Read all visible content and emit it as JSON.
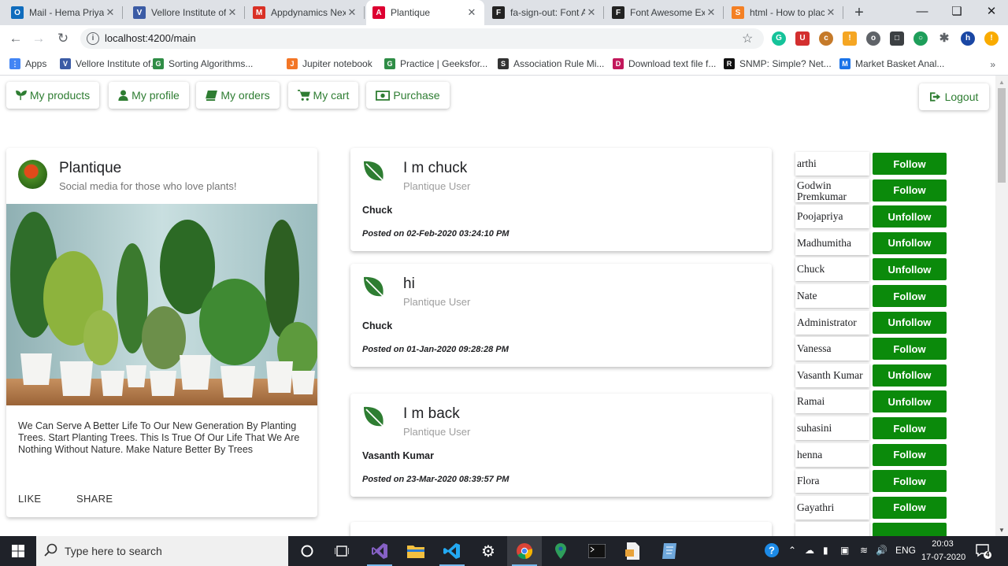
{
  "browser": {
    "tabs": [
      {
        "title": "Mail - Hema Priya",
        "favicon": "outlook-icon",
        "color": "#0f6cbd",
        "glyph": "O"
      },
      {
        "title": "Vellore Institute of",
        "favicon": "vit-icon",
        "color": "#3b5ba5",
        "glyph": "V"
      },
      {
        "title": "Appdynamics Nex",
        "favicon": "gmail-icon",
        "color": "#d93025",
        "glyph": "M"
      },
      {
        "title": "Plantique",
        "favicon": "angular-icon",
        "color": "#dd0031",
        "glyph": "A",
        "active": true
      },
      {
        "title": "fa-sign-out: Font A",
        "favicon": "flag-icon",
        "color": "#222222",
        "glyph": "F"
      },
      {
        "title": "Font Awesome Exa",
        "favicon": "flag-icon",
        "color": "#222222",
        "glyph": "F"
      },
      {
        "title": "html - How to plac",
        "favicon": "stackoverflow-icon",
        "color": "#f48024",
        "glyph": "S"
      }
    ],
    "url": "localhost:4200/main",
    "bookmarks": [
      {
        "label": "Apps",
        "color": "#4285f4",
        "glyph": "⋮"
      },
      {
        "label": "Vellore Institute of...",
        "color": "#3b5ba5",
        "glyph": "V"
      },
      {
        "label": "Sorting Algorithms...",
        "color": "#2f8d46",
        "glyph": "G"
      },
      {
        "label": "Jupiter notebook",
        "color": "#f37626",
        "glyph": "J"
      },
      {
        "label": "Practice | Geeksfor...",
        "color": "#2f8d46",
        "glyph": "G"
      },
      {
        "label": "Association Rule Mi...",
        "color": "#333333",
        "glyph": "S"
      },
      {
        "label": "Download text file f...",
        "color": "#c2185b",
        "glyph": "D"
      },
      {
        "label": "SNMP: Simple? Net...",
        "color": "#111111",
        "glyph": "R"
      },
      {
        "label": "Market Basket Anal...",
        "color": "#1a73e8",
        "glyph": "M"
      }
    ],
    "bookmarks_more": "»",
    "profile_initial": "h"
  },
  "nav": {
    "my_products": "My products",
    "my_profile": "My profile",
    "my_orders": "My orders",
    "my_cart": "My cart",
    "purchase": "Purchase",
    "logout": "Logout"
  },
  "profile": {
    "title": "Plantique",
    "subtitle": "Social media for those who love plants!",
    "description": "We Can Serve A Better Life To Our New Generation By Planting Trees. Start Planting Trees. This Is True Of Our Life That We Are Nothing Without Nature. Make Nature Better By Trees",
    "like": "LIKE",
    "share": "SHARE"
  },
  "posts": [
    {
      "title": "I m chuck",
      "user": "Plantique User",
      "author": "Chuck",
      "date": "Posted on 02-Feb-2020 03:24:10 PM"
    },
    {
      "title": "hi",
      "user": "Plantique User",
      "author": "Chuck",
      "date": "Posted on 01-Jan-2020 09:28:28 PM"
    },
    {
      "title": "I m back",
      "user": "Plantique User",
      "author": "Vasanth Kumar",
      "date": "Posted on 23-Mar-2020 08:39:57 PM"
    }
  ],
  "users": [
    {
      "name": "arthi",
      "action": "Follow"
    },
    {
      "name": "Godwin Premkumar",
      "action": "Follow"
    },
    {
      "name": "Poojapriya",
      "action": "Unfollow"
    },
    {
      "name": "Madhumitha",
      "action": "Unfollow"
    },
    {
      "name": "Chuck",
      "action": "Unfollow"
    },
    {
      "name": "Nate",
      "action": "Follow"
    },
    {
      "name": "Administrator",
      "action": "Unfollow"
    },
    {
      "name": "Vanessa",
      "action": "Follow"
    },
    {
      "name": "Vasanth Kumar",
      "action": "Unfollow"
    },
    {
      "name": "Ramai",
      "action": "Unfollow"
    },
    {
      "name": "suhasini",
      "action": "Follow"
    },
    {
      "name": "henna",
      "action": "Follow"
    },
    {
      "name": "Flora",
      "action": "Follow"
    },
    {
      "name": "Gayathri",
      "action": "Follow"
    }
  ],
  "taskbar": {
    "search_placeholder": "Type here to search",
    "language": "ENG",
    "time": "20:03",
    "date": "17-07-2020",
    "notification_count": "4"
  },
  "colors": {
    "accent_green": "#2e7d32",
    "button_green": "#0b8a0b",
    "taskbar": "#1f2229"
  }
}
